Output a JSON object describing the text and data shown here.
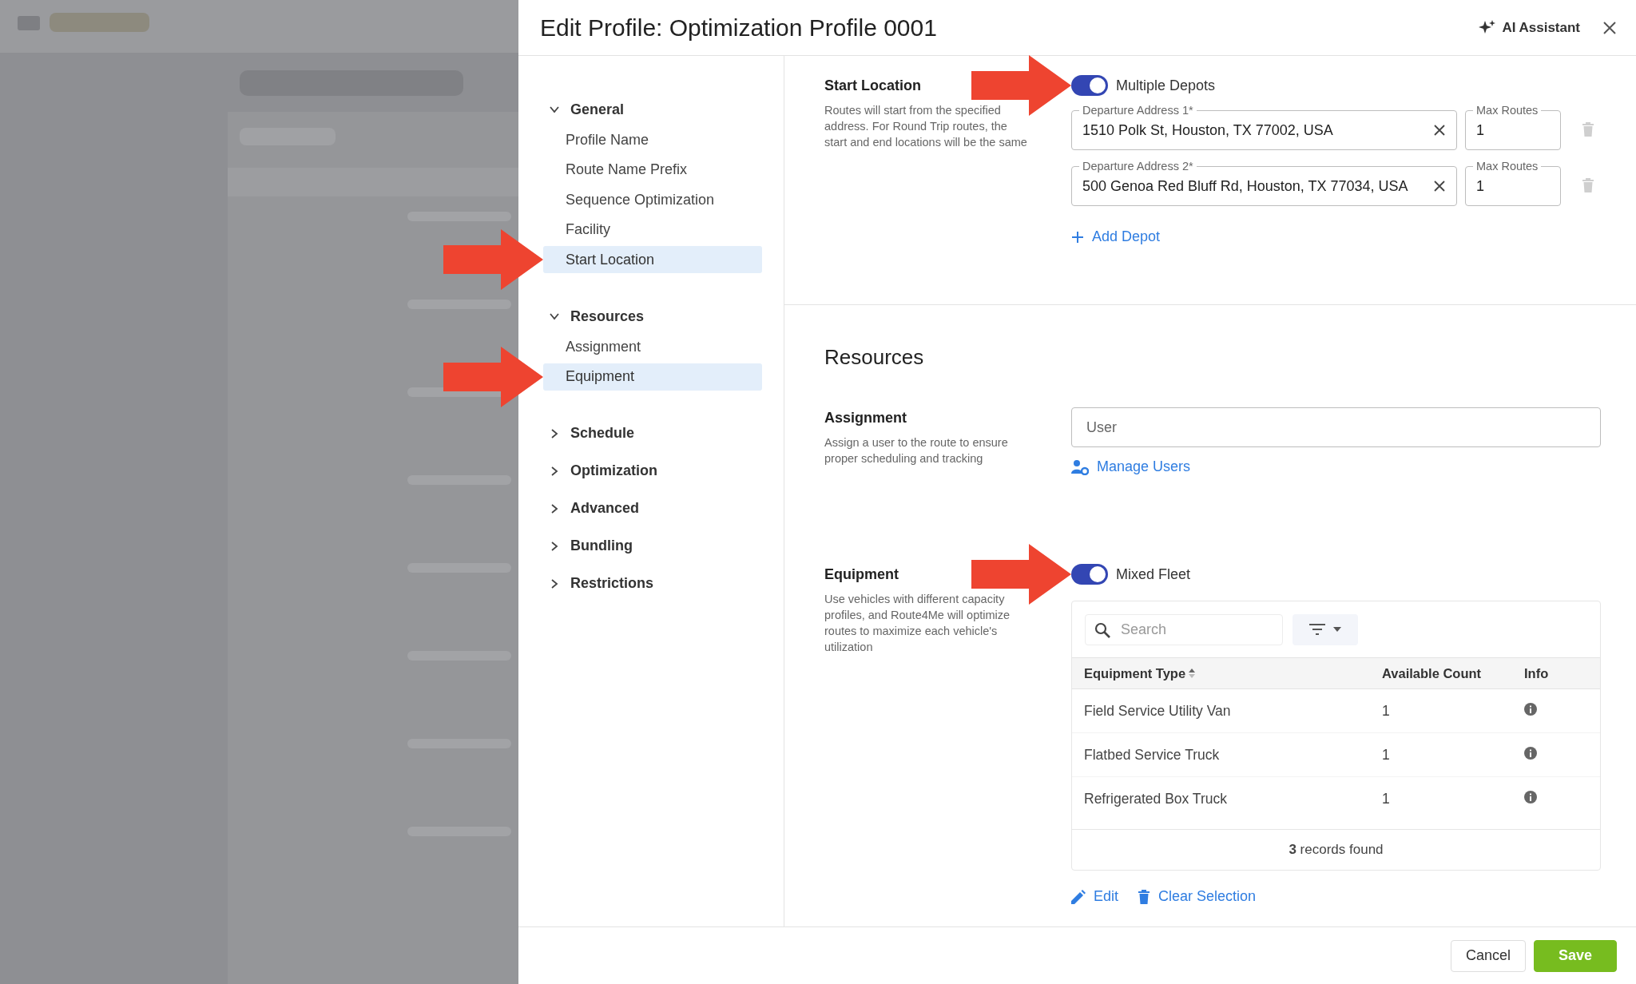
{
  "dialog": {
    "title": "Edit Profile: Optimization Profile 0001",
    "assistant": "AI Assistant"
  },
  "nav": [
    {
      "label": "General",
      "expanded": true,
      "children": [
        {
          "label": "Profile Name",
          "selected": false,
          "callout": false
        },
        {
          "label": "Route Name Prefix",
          "selected": false,
          "callout": false
        },
        {
          "label": "Sequence Optimization",
          "selected": false,
          "callout": false
        },
        {
          "label": "Facility",
          "selected": false,
          "callout": false
        },
        {
          "label": "Start Location",
          "selected": true,
          "callout": true
        }
      ]
    },
    {
      "label": "Resources",
      "expanded": true,
      "children": [
        {
          "label": "Assignment",
          "selected": false,
          "callout": false
        },
        {
          "label": "Equipment",
          "selected": true,
          "callout": true
        }
      ]
    },
    {
      "label": "Schedule",
      "expanded": false
    },
    {
      "label": "Optimization",
      "expanded": false
    },
    {
      "label": "Advanced",
      "expanded": false
    },
    {
      "label": "Bundling",
      "expanded": false
    },
    {
      "label": "Restrictions",
      "expanded": false
    }
  ],
  "start_location": {
    "label": "Start Location",
    "description": "Routes will start from the specified address. For Round Trip routes, the start and end locations will be the same",
    "toggle": {
      "label": "Multiple Depots",
      "on": true,
      "callout": true
    },
    "depots": [
      {
        "address_label": "Departure Address 1*",
        "address": "1510 Polk St, Houston, TX 77002, USA",
        "routes_label": "Max Routes",
        "routes": "1"
      },
      {
        "address_label": "Departure Address 2*",
        "address": "500 Genoa Red Bluff Rd, Houston, TX 77034, USA",
        "routes_label": "Max Routes",
        "routes": "1"
      }
    ],
    "add_link": "Add Depot"
  },
  "resources": {
    "heading": "Resources",
    "assignment": {
      "label": "Assignment",
      "description": "Assign a user to the route to ensure proper scheduling and tracking",
      "placeholder": "User",
      "link": "Manage Users"
    },
    "equipment": {
      "label": "Equipment",
      "description": "Use vehicles with different capacity profiles, and Route4Me will optimize routes to maximize each vehicle's utilization",
      "toggle": {
        "label": "Mixed Fleet",
        "on": true,
        "callout": true
      },
      "search": {
        "placeholder": "Search"
      },
      "columns": [
        "Equipment Type",
        "Available Count",
        "Info"
      ],
      "rows": [
        {
          "type": "Field Service Utility Van",
          "count": "1"
        },
        {
          "type": "Flatbed Service Truck",
          "count": "1"
        },
        {
          "type": "Refrigerated Box Truck",
          "count": "1"
        }
      ],
      "footer": "**3** records found",
      "actions": [
        {
          "kind": "edit",
          "label": "Edit"
        },
        {
          "kind": "clear",
          "label": "Clear Selection"
        }
      ]
    }
  },
  "buttons": [
    {
      "kind": "secondary",
      "label": "Cancel"
    },
    {
      "kind": "primary",
      "label": "Save"
    }
  ]
}
